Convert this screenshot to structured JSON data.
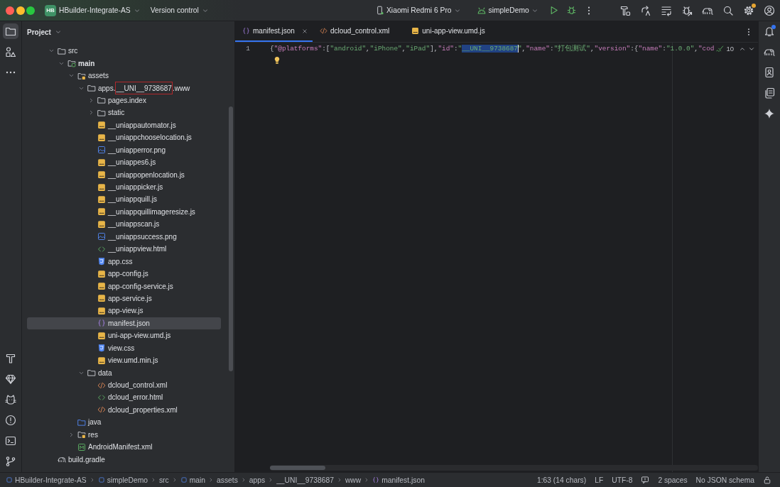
{
  "title_bar": {
    "badge": "HB",
    "project": "HBuilder-Integrate-AS",
    "vcs": "Version control",
    "device": "Xiaomi Redmi 6 Pro",
    "run_config": "simpleDemo",
    "tools": [
      {
        "kind": "make",
        "badge": false
      },
      {
        "kind": "translate",
        "badge": false
      },
      {
        "kind": "list",
        "badge": false
      },
      {
        "kind": "inspect",
        "badge": false
      },
      {
        "kind": "gradle",
        "badge": false
      },
      {
        "kind": "search",
        "badge": false
      },
      {
        "kind": "settings",
        "badge": true
      },
      {
        "kind": "account",
        "badge": false
      }
    ]
  },
  "left_strip": {
    "top": [
      {
        "kind": "project",
        "selected": true
      },
      {
        "kind": "structure",
        "selected": false
      },
      {
        "kind": "more",
        "selected": false
      }
    ],
    "bottom": [
      {
        "kind": "build",
        "selected": false
      },
      {
        "kind": "quality",
        "selected": false
      },
      {
        "kind": "logcat",
        "selected": false
      },
      {
        "kind": "problems",
        "selected": false
      },
      {
        "kind": "terminal",
        "selected": false
      },
      {
        "kind": "git",
        "selected": false
      }
    ]
  },
  "right_strip": [
    {
      "kind": "notifications",
      "badge": true
    },
    {
      "kind": "gradle",
      "badge": false
    },
    {
      "kind": "devices",
      "badge": false
    },
    {
      "kind": "copy",
      "badge": false
    },
    {
      "kind": "assistant",
      "badge": false
    }
  ],
  "project_panel": {
    "title": "Project",
    "tree": [
      {
        "name": "src",
        "kind": "folder",
        "expanded": true,
        "selected": false,
        "children": [
          {
            "name": "main",
            "kind": "modulefolder",
            "expanded": true,
            "selected": false,
            "children": [
              {
                "name": "assets",
                "kind": "resfolder",
                "expanded": true,
                "selected": false,
                "children": [
                  {
                    "name_parts": [
                      {
                        "text": "apps.",
                        "boxed": false
                      },
                      {
                        "text": "__UNI__9738687",
                        "boxed": true
                      },
                      {
                        "text": ".www",
                        "boxed": false
                      }
                    ],
                    "kind": "folder",
                    "expanded": true,
                    "selected": false,
                    "children": [
                      {
                        "name": "pages.index",
                        "kind": "folder",
                        "expanded": false,
                        "selected": false
                      },
                      {
                        "name": "static",
                        "kind": "folder",
                        "expanded": false,
                        "selected": false
                      },
                      {
                        "name": "__uniappautomator.js",
                        "kind": "js",
                        "selected": false
                      },
                      {
                        "name": "__uniappchooselocation.js",
                        "kind": "js",
                        "selected": false
                      },
                      {
                        "name": "__uniapperror.png",
                        "kind": "image",
                        "selected": false
                      },
                      {
                        "name": "__uniappes6.js",
                        "kind": "js",
                        "selected": false
                      },
                      {
                        "name": "__uniappopenlocation.js",
                        "kind": "js",
                        "selected": false
                      },
                      {
                        "name": "__uniapppicker.js",
                        "kind": "js",
                        "selected": false
                      },
                      {
                        "name": "__uniappquill.js",
                        "kind": "js",
                        "selected": false
                      },
                      {
                        "name": "__uniappquillimageresize.js",
                        "kind": "js",
                        "selected": false
                      },
                      {
                        "name": "__uniappscan.js",
                        "kind": "js",
                        "selected": false
                      },
                      {
                        "name": "__uniappsuccess.png",
                        "kind": "image",
                        "selected": false
                      },
                      {
                        "name": "__uniappview.html",
                        "kind": "html",
                        "selected": false
                      },
                      {
                        "name": "app.css",
                        "kind": "css",
                        "selected": false
                      },
                      {
                        "name": "app-config.js",
                        "kind": "js",
                        "selected": false
                      },
                      {
                        "name": "app-config-service.js",
                        "kind": "js",
                        "selected": false
                      },
                      {
                        "name": "app-service.js",
                        "kind": "js",
                        "selected": false
                      },
                      {
                        "name": "app-view.js",
                        "kind": "js",
                        "selected": false
                      },
                      {
                        "name": "manifest.json",
                        "kind": "json",
                        "selected": true
                      },
                      {
                        "name": "uni-app-view.umd.js",
                        "kind": "js",
                        "selected": false
                      },
                      {
                        "name": "view.css",
                        "kind": "css",
                        "selected": false
                      },
                      {
                        "name": "view.umd.min.js",
                        "kind": "js",
                        "selected": false
                      }
                    ]
                  },
                  {
                    "name": "data",
                    "kind": "folder",
                    "expanded": true,
                    "selected": false,
                    "children": [
                      {
                        "name": "dcloud_control.xml",
                        "kind": "xml",
                        "selected": false
                      },
                      {
                        "name": "dcloud_error.html",
                        "kind": "html",
                        "selected": false
                      },
                      {
                        "name": "dcloud_properties.xml",
                        "kind": "xml",
                        "selected": false
                      }
                    ]
                  }
                ]
              },
              {
                "name": "java",
                "kind": "srcfolder",
                "selected": false
              },
              {
                "name": "res",
                "kind": "resfolder",
                "expanded": false,
                "selected": false
              },
              {
                "name": "AndroidManifest.xml",
                "kind": "manifest",
                "selected": false
              }
            ]
          }
        ]
      },
      {
        "name": "build.gradle",
        "kind": "gradle",
        "selected": false
      }
    ]
  },
  "tabs": [
    {
      "label": "manifest.json",
      "kind": "json",
      "selected": true
    },
    {
      "label": "dcloud_control.xml",
      "kind": "xml",
      "selected": false
    },
    {
      "label": "uni-app-view.umd.js",
      "kind": "js",
      "selected": false
    }
  ],
  "editor": {
    "line_number": "1",
    "tokens": [
      {
        "kind": "punct",
        "text": "{"
      },
      {
        "kind": "key",
        "text": "\"@platforms\""
      },
      {
        "kind": "punct",
        "text": ":["
      },
      {
        "kind": "string",
        "text": "\"android\""
      },
      {
        "kind": "punct",
        "text": ","
      },
      {
        "kind": "string",
        "text": "\"iPhone\""
      },
      {
        "kind": "punct",
        "text": ","
      },
      {
        "kind": "string",
        "text": "\"iPad\""
      },
      {
        "kind": "punct",
        "text": "],"
      },
      {
        "kind": "key",
        "text": "\"id\""
      },
      {
        "kind": "punct",
        "text": ":"
      },
      {
        "kind": "string",
        "text": "\""
      },
      {
        "kind": "selection",
        "text": "__UNI__9738687"
      },
      {
        "kind": "string",
        "text": "\""
      },
      {
        "kind": "punct",
        "text": ","
      },
      {
        "kind": "key",
        "text": "\"name\""
      },
      {
        "kind": "punct",
        "text": ":"
      },
      {
        "kind": "string",
        "text": "\"打包测试\""
      },
      {
        "kind": "punct",
        "text": ","
      },
      {
        "kind": "key",
        "text": "\"version\""
      },
      {
        "kind": "punct",
        "text": ":{"
      },
      {
        "kind": "key",
        "text": "\"name\""
      },
      {
        "kind": "punct",
        "text": ":"
      },
      {
        "kind": "string",
        "text": "\"1.0.0\""
      },
      {
        "kind": "punct",
        "text": ","
      },
      {
        "kind": "key",
        "text": "\"cod"
      }
    ],
    "problems": "10"
  },
  "status_bar": {
    "breadcrumbs": [
      {
        "label": "HBuilder-Integrate-AS",
        "kind": "module"
      },
      {
        "label": "simpleDemo",
        "kind": "module"
      },
      {
        "label": "src",
        "kind": "plain"
      },
      {
        "label": "main",
        "kind": "module"
      },
      {
        "label": "assets",
        "kind": "plain"
      },
      {
        "label": "apps",
        "kind": "plain"
      },
      {
        "label": "__UNI__9738687",
        "kind": "plain"
      },
      {
        "label": "www",
        "kind": "plain"
      },
      {
        "label": "manifest.json",
        "kind": "json"
      }
    ],
    "position": "1:63 (14 chars)",
    "line_separator": "LF",
    "encoding": "UTF-8",
    "indent": "2 spaces",
    "schema": "No JSON schema"
  }
}
